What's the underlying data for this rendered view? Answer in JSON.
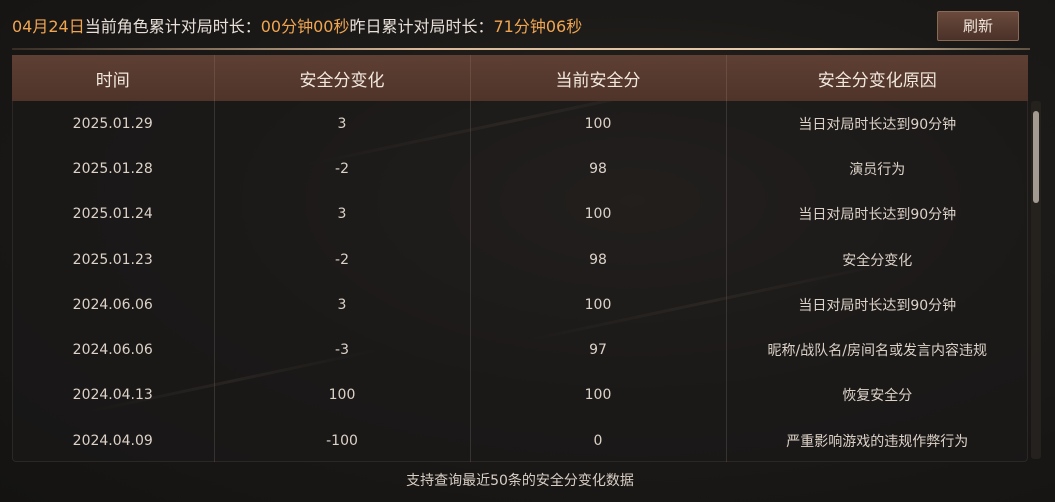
{
  "summary": {
    "date": "04月24日",
    "current_label": "当前角色累计对局时长：",
    "current_value": "00分钟00秒",
    "yesterday_label": "昨日累计对局时长：",
    "yesterday_value": "71分钟06秒"
  },
  "toolbar": {
    "refresh_label": "刷新"
  },
  "table": {
    "headers": [
      "时间",
      "安全分变化",
      "当前安全分",
      "安全分变化原因"
    ],
    "rows": [
      [
        "2025.01.29",
        "3",
        "100",
        "当日对局时长达到90分钟"
      ],
      [
        "2025.01.28",
        "-2",
        "98",
        "演员行为"
      ],
      [
        "2025.01.24",
        "3",
        "100",
        "当日对局时长达到90分钟"
      ],
      [
        "2025.01.23",
        "-2",
        "98",
        "安全分变化"
      ],
      [
        "2024.06.06",
        "3",
        "100",
        "当日对局时长达到90分钟"
      ],
      [
        "2024.06.06",
        "-3",
        "97",
        "昵称/战队名/房间名或发言内容违规"
      ],
      [
        "2024.04.13",
        "100",
        "100",
        "恢复安全分"
      ],
      [
        "2024.04.09",
        "-100",
        "0",
        "严重影响游戏的违规作弊行为"
      ]
    ]
  },
  "footer": {
    "note": "支持查询最近50条的安全分变化数据"
  },
  "colors": {
    "highlight": "#f0a550",
    "header_bg": "#5e3f33",
    "button_bg": "#5a3d31"
  }
}
